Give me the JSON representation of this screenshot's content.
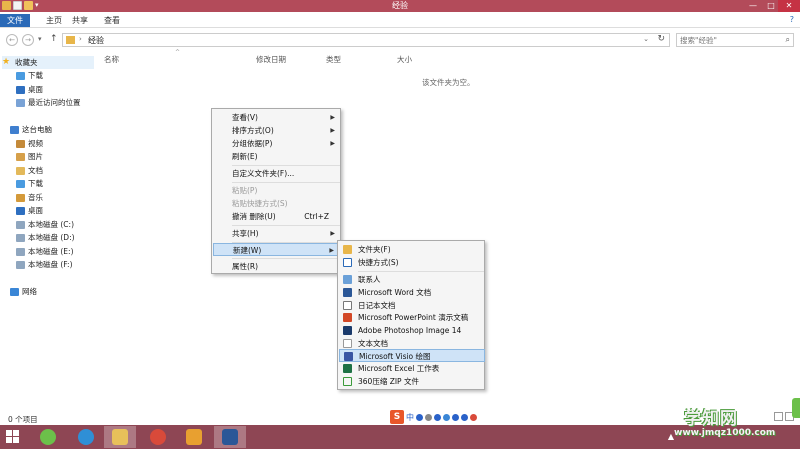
{
  "window": {
    "title": "经验",
    "minimize": "—",
    "maximize": "□",
    "close": "✕"
  },
  "ribbon": {
    "tabs": [
      "文件",
      "主页",
      "共享",
      "查看"
    ],
    "help": "?"
  },
  "address": {
    "path": "经验",
    "search_placeholder": "搜索\"经验\""
  },
  "nav": {
    "favorites": "收藏夹",
    "fav_items": [
      "下载",
      "桌面",
      "最近访问的位置"
    ],
    "this_pc": "这台电脑",
    "pc_items": [
      "视频",
      "图片",
      "文档",
      "下载",
      "音乐",
      "桌面",
      "本地磁盘 (C:)",
      "本地磁盘 (D:)",
      "本地磁盘 (E:)",
      "本地磁盘 (F:)"
    ],
    "network": "网络"
  },
  "columns": [
    "名称",
    "修改日期",
    "类型",
    "大小"
  ],
  "empty_message": "该文件夹为空。",
  "context_menu": {
    "view": "查看(V)",
    "sort": "排序方式(O)",
    "group": "分组依据(P)",
    "refresh": "刷新(E)",
    "customize": "自定义文件夹(F)...",
    "paste": "粘贴(P)",
    "paste_shortcut": "粘贴快捷方式(S)",
    "undo": "撤消 删除(U)",
    "undo_shortcut": "Ctrl+Z",
    "share": "共享(H)",
    "new": "新建(W)",
    "properties": "属性(R)"
  },
  "new_submenu": [
    {
      "label": "文件夹(F)",
      "icon": "folder-icon"
    },
    {
      "label": "快捷方式(S)",
      "icon": "shortcut-icon"
    },
    {
      "label": "联系人",
      "icon": "contact-icon"
    },
    {
      "label": "Microsoft Word 文档",
      "icon": "word-icon"
    },
    {
      "label": "日记本文档",
      "icon": "journal-icon"
    },
    {
      "label": "Microsoft PowerPoint 演示文稿",
      "icon": "powerpoint-icon"
    },
    {
      "label": "Adobe Photoshop Image 14",
      "icon": "photoshop-icon"
    },
    {
      "label": "文本文档",
      "icon": "text-document-icon"
    },
    {
      "label": "Microsoft Visio 绘图",
      "icon": "visio-icon"
    },
    {
      "label": "Microsoft Excel 工作表",
      "icon": "excel-icon"
    },
    {
      "label": "360压缩 ZIP 文件",
      "icon": "zip-icon"
    }
  ],
  "status": {
    "items": "0 个项目"
  },
  "ime": {
    "logo": "S",
    "mode": "中"
  },
  "watermark": {
    "title": "学知网",
    "url": "www.jmqz1000.com"
  }
}
